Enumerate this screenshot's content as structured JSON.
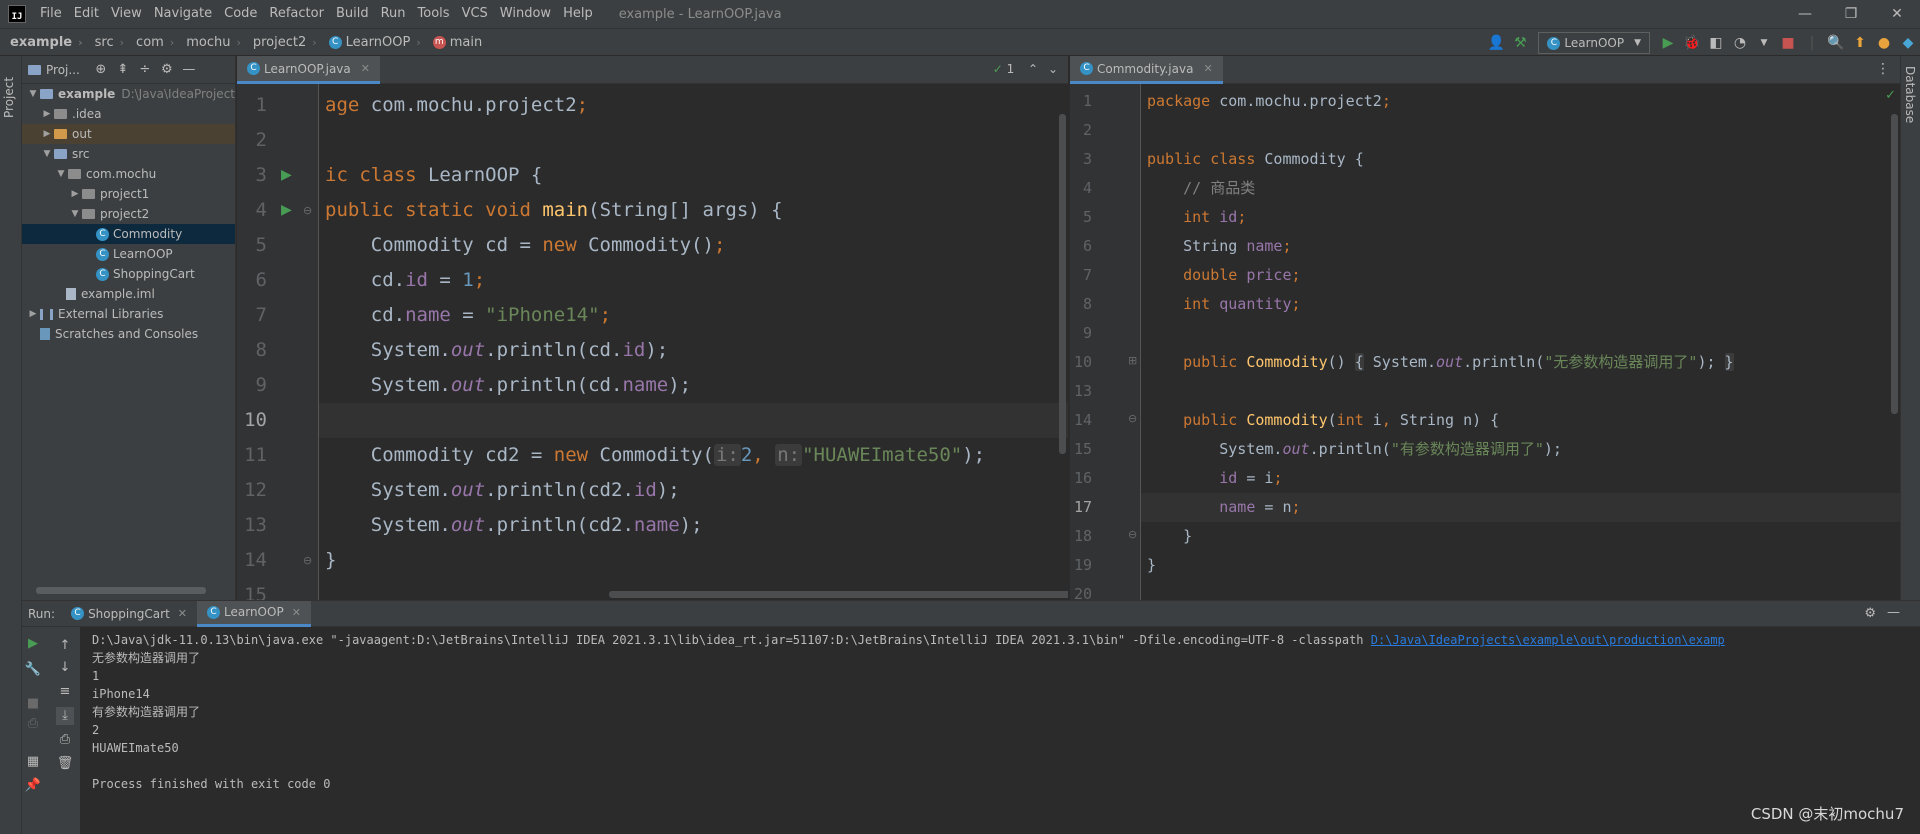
{
  "menubar": {
    "logo": "IJ",
    "items": [
      "File",
      "Edit",
      "View",
      "Navigate",
      "Code",
      "Refactor",
      "Build",
      "Run",
      "Tools",
      "VCS",
      "Window",
      "Help"
    ],
    "title": "example - LearnOOP.java"
  },
  "breadcrumb": [
    "example",
    "src",
    "com",
    "mochu",
    "project2",
    "LearnOOP",
    "main"
  ],
  "run_config": "LearnOOP",
  "left_stripe": {
    "label": "Project"
  },
  "right_stripe": {
    "label": "Database"
  },
  "project": {
    "header_label": "Proj...",
    "tree": [
      {
        "name": "example",
        "path": "D:\\Java\\IdeaProject"
      },
      {
        "name": ".idea"
      },
      {
        "name": "out"
      },
      {
        "name": "src"
      },
      {
        "name": "com.mochu"
      },
      {
        "name": "project1"
      },
      {
        "name": "project2"
      },
      {
        "name": "Commodity"
      },
      {
        "name": "LearnOOP"
      },
      {
        "name": "ShoppingCart"
      },
      {
        "name": "example.iml"
      },
      {
        "name": "External Libraries"
      },
      {
        "name": "Scratches and Consoles"
      }
    ]
  },
  "left_editor": {
    "tab": "LearnOOP.java",
    "inspection": "1",
    "line_numbers": [
      "1",
      "2",
      "3",
      "4",
      "5",
      "6",
      "7",
      "8",
      "9",
      "10",
      "11",
      "12",
      "13",
      "14",
      "15"
    ],
    "code": {
      "l1a": "age",
      "l1b": " com.mochu.project2",
      "l1c": ";",
      "l3a": "ic class",
      "l3b": " LearnOOP {",
      "l4a": "public static void",
      "l4b": "main",
      "l4c": "(String[] args) {",
      "l5a": "    Commodity cd = ",
      "l5b": "new",
      "l5c": " Commodity()",
      "l5d": ";",
      "l6a": "    cd.",
      "l6b": "id",
      "l6c": " = ",
      "l6d": "1",
      "l6e": ";",
      "l7a": "    cd.",
      "l7b": "name",
      "l7c": " = ",
      "l7d": "\"iPhone14\"",
      "l7e": ";",
      "l8a": "    System.",
      "l8b": "out",
      "l8c": ".println(cd.",
      "l8d": "id",
      "l8e": ");",
      "l9a": "    System.",
      "l9b": "out",
      "l9c": ".println(cd.",
      "l9d": "name",
      "l9e": ");",
      "l11a": "    Commodity cd2 = ",
      "l11b": "new",
      "l11c": " Commodity(",
      "l11h1": "i:",
      "l11d": "2",
      "l11e": ", ",
      "l11h2": "n:",
      "l11f": "\"HUAWEImate50\"",
      "l11g": ");",
      "l12a": "    System.",
      "l12b": "out",
      "l12c": ".println(cd2.",
      "l12d": "id",
      "l12e": ");",
      "l13a": "    System.",
      "l13b": "out",
      "l13c": ".println(cd2.",
      "l13d": "name",
      "l13e": ");",
      "l14a": "}"
    }
  },
  "right_editor": {
    "tab": "Commodity.java",
    "line_numbers": [
      "1",
      "2",
      "3",
      "4",
      "5",
      "6",
      "7",
      "8",
      "9",
      "10",
      "13",
      "14",
      "15",
      "16",
      "17",
      "18",
      "19",
      "20"
    ],
    "code": {
      "r1a": "package",
      "r1b": " com.mochu.project2",
      "r1c": ";",
      "r3a": "public class",
      "r3b": " Commodity {",
      "r4a": "    // 商品类",
      "r5a": "    int",
      "r5b": " id",
      "r5c": ";",
      "r6a": "    String ",
      "r6b": "name",
      "r6c": ";",
      "r7a": "    double",
      "r7b": " price",
      "r7c": ";",
      "r8a": "    int",
      "r8b": " quantity",
      "r8c": ";",
      "r10a": "    public",
      "r10b": " Commodity",
      "r10c": "()",
      "r10d": "{",
      "r10e": " System.",
      "r10f": "out",
      "r10g": ".println(",
      "r10h": "\"无参数构造器调用了\"",
      "r10i": ");",
      "r10j": "}",
      "r14a": "    public",
      "r14b": " Commodity",
      "r14c": "(",
      "r14d": "int",
      "r14e": " i",
      "r14f": ",",
      "r14g": " String n) {",
      "r15a": "        System.",
      "r15b": "out",
      "r15c": ".println(",
      "r15d": "\"有参数构造器调用了\"",
      "r15e": ");",
      "r16a": "        ",
      "r16b": "id",
      "r16c": " = i",
      "r16d": ";",
      "r17a": "        ",
      "r17b": "name",
      "r17c": " = n",
      "r17d": ";",
      "r18a": "    }",
      "r19a": "}"
    }
  },
  "run_panel": {
    "label": "Run:",
    "tabs": [
      "ShoppingCart",
      "LearnOOP"
    ],
    "console": {
      "cmd": "D:\\Java\\jdk-11.0.13\\bin\\java.exe \"-javaagent:D:\\JetBrains\\IntelliJ IDEA 2021.3.1\\lib\\idea_rt.jar=51107:D:\\JetBrains\\IntelliJ IDEA 2021.3.1\\bin\" -Dfile.encoding=UTF-8 -classpath ",
      "cmd_link": "D:\\Java\\IdeaProjects\\example\\out\\production\\examp",
      "lines": [
        "无参数构造器调用了",
        "1",
        "iPhone14",
        "有参数构造器调用了",
        "2",
        "HUAWEImate50",
        "",
        "Process finished with exit code 0"
      ]
    }
  },
  "watermark": "CSDN @末初mochu7",
  "colors": {
    "keyword": "#cc7832",
    "string": "#6a8759",
    "number": "#6897bb",
    "field": "#9876aa",
    "method": "#ffc66d",
    "run_green": "#499c54"
  }
}
